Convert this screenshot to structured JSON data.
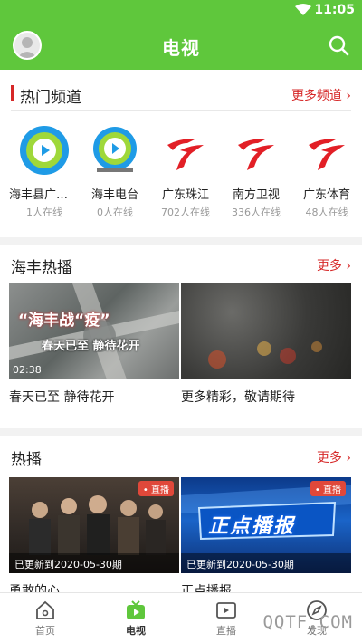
{
  "status_bar": {
    "time": "11:05"
  },
  "app_bar": {
    "title": "电视"
  },
  "hot_channels": {
    "title": "热门频道",
    "more": "更多频道",
    "items": [
      {
        "name": "海丰县广播电视台",
        "count": "1人在线"
      },
      {
        "name": "海丰电台",
        "count": "0人在线"
      },
      {
        "name": "广东珠江",
        "count": "702人在线"
      },
      {
        "name": "南方卫视",
        "count": "336人在线"
      },
      {
        "name": "广东体育",
        "count": "48人在线"
      }
    ]
  },
  "haifeng_hot": {
    "title": "海丰热播",
    "more": "更多",
    "items": [
      {
        "caption": "春天已至 静待花开",
        "duration": "02:38",
        "overlay_lines": [
          "“海丰战“疫”",
          "春天已至 静待花开"
        ]
      },
      {
        "caption": "更多精彩，敬请期待"
      }
    ]
  },
  "hot_play": {
    "title": "热播",
    "more": "更多",
    "items": [
      {
        "caption": "勇敢的心",
        "badge": "直播",
        "updated": "已更新到2020-05-30期"
      },
      {
        "caption": "正点播报",
        "badge": "直播",
        "updated": "已更新到2020-05-30期",
        "overlay_title": "正点播报"
      }
    ]
  },
  "tabs": [
    {
      "label": "首页",
      "icon": "home-icon"
    },
    {
      "label": "电视",
      "icon": "tv-icon",
      "active": true
    },
    {
      "label": "直播",
      "icon": "live-icon"
    },
    {
      "label": "发现",
      "icon": "compass-icon"
    }
  ],
  "watermark": "QQTF.COM",
  "colors": {
    "brand_green": "#5fc73c",
    "accent_red": "#d62828",
    "badge_red": "#e0483a"
  }
}
